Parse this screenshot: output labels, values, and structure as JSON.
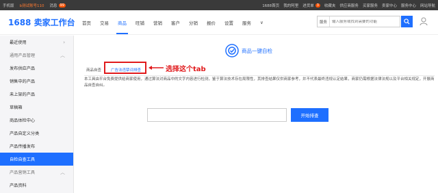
{
  "topbar": {
    "items": [
      "手机版",
      "b测试账号110",
      "消息",
      "1688首页",
      "我的阿里",
      "进货单",
      "收藏夹",
      "供应商服务",
      "买家服务",
      "卖家中心",
      "服务中心",
      "网站导航"
    ],
    "badge_messages": "99",
    "badge_cart": "3"
  },
  "header": {
    "logo": "1688 卖家工作台",
    "nav": [
      "首页",
      "交易",
      "商品",
      "旺铺",
      "营销",
      "客户",
      "分销",
      "报价",
      "设置",
      "服务"
    ],
    "nav_chevron": "∨",
    "search_scope": "服务",
    "search_placeholder": "输入服务或找到需要的功能"
  },
  "sidebar": {
    "recent": "最近使用",
    "group1": "通用产品管理",
    "items": [
      "发布供应产品",
      "销售中的产品",
      "未上架的产品",
      "草稿箱",
      "商品体检中心",
      "产品自定义分类",
      "产品传播发布",
      "自检自查工具"
    ],
    "group2": "产品营销工具",
    "cut_item": "产品资料"
  },
  "main": {
    "title": "商品一键自检",
    "tabs": [
      "商品自查",
      "广告法违禁词排查"
    ],
    "annotation": "选择这个tab",
    "description": "本工具由平台免费提供给商家使用，通过算法对商品中的文字内容进行检测，鉴于算法技术存在局限性，其排查结果仅供商家参考，并不代表最终违规认定结果，商家仍需根据法律法规以及平台相关规定，开展商品自查自纠。",
    "start_button": "开始排查",
    "input_value": ""
  },
  "colors": {
    "accent": "#1e6fff",
    "annotation": "#e0191b"
  }
}
